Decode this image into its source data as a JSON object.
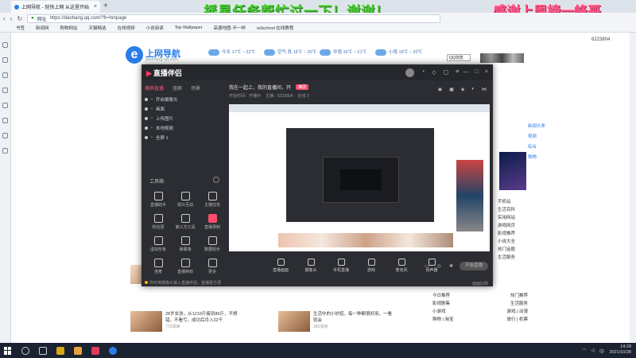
{
  "browser": {
    "tab_title": "上网导航 - 轻快上网 从这里开始",
    "url_label": "网址",
    "url": "https://daohang.qq.com/?fr=hmpage",
    "bookmarks": [
      "书签",
      "新闻网",
      "购物网站",
      "天猫精选",
      "在线视频",
      "小说阅读",
      "Top Wallpaper",
      "高德地图-不一样",
      "w3school 在线教程"
    ]
  },
  "overlay": {
    "left_text": "摇星任务帮忙过一下！谢谢！",
    "right_text": "感谢上周榜一峰哥"
  },
  "webpage": {
    "logo_title": "上网导航",
    "logo_sub": "daohang.qq.com",
    "weather": [
      {
        "label": "今天",
        "temp": "17℃ ~ 22℃"
      },
      {
        "label": "空气 良",
        "temp": "15℃ ~ 20℃"
      },
      {
        "label": "中雨",
        "temp": "16℃ ~ 21℃"
      },
      {
        "label": "小雨",
        "temp": "18℃ ~ 20℃"
      }
    ],
    "region": "QQ浏览",
    "counter": "6223804",
    "right_list": [
      "手机站",
      "生活百科",
      "实用网站",
      "游戏网页",
      "影视推荐",
      "小说大全",
      "热门话题",
      "生活服务"
    ],
    "right_list2": [
      "新闻头条",
      "视频",
      "综合",
      "购物"
    ],
    "news": [
      {
        "text": "28岁女孩，从1210斤瘦到86斤，不想错，不看亏，成功后月入22千",
        "count": "772阅读"
      },
      {
        "text": "生活中的小妙招，每一种都很好用，一看就会",
        "count": "365阅读"
      }
    ],
    "links": [
      {
        "left": "今日推荐",
        "right": "热门推荐"
      },
      {
        "left": "影视剧集",
        "right": "生活服务"
      },
      {
        "left": "小游戏",
        "right": "游戏 | 动漫"
      },
      {
        "left": "购物 | 淘宝",
        "right": "旅行 | 机票"
      }
    ]
  },
  "app": {
    "title": "直播伴侣",
    "scene_tabs": [
      "横屏直播",
      "竖屏",
      "场景"
    ],
    "scenes": [
      "开启摄像头",
      "画面",
      "上传图片",
      "本地视频",
      "全屏 1"
    ],
    "toolbox_label": "工具箱",
    "tools": [
      "直播助手",
      "观众互动",
      "主播任务",
      "粉丝团",
      "第三方工具",
      "直播录制",
      "虚拟形象",
      "弹幕墙",
      "数据助手",
      "连麦",
      "直播特效",
      "更多"
    ],
    "stream_title": "我在一起上，我的直播间，开",
    "stream_tag": "横屏",
    "stream_meta": [
      "开始时间：开播中",
      "主播：6223804",
      "在线 0"
    ],
    "bottom_buttons": [
      "直播画面",
      "摄像头",
      "手机直播",
      "游戏",
      "麦克风",
      "扬声器"
    ],
    "start_label": "开始直播",
    "footer_note": "你可将摄像头接入直播伴侣，直播更方便",
    "bottom_right_text": "画面比例"
  },
  "taskbar": {
    "time": "14:28",
    "date": "2021/10/28"
  }
}
